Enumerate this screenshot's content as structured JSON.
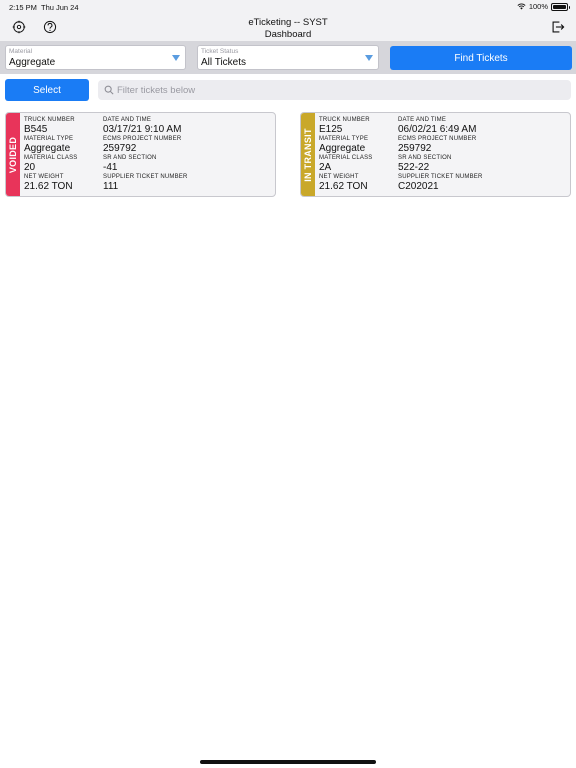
{
  "status_bar": {
    "time": "2:15 PM",
    "date": "Thu Jun 24",
    "battery": "100%"
  },
  "nav": {
    "title_line1": "eTicketing -- SYST",
    "title_line2": "Dashboard"
  },
  "filters": {
    "material": {
      "label": "Material",
      "value": "Aggregate"
    },
    "status": {
      "label": "Ticket Status",
      "value": "All Tickets"
    },
    "find_label": "Find Tickets"
  },
  "actions": {
    "select_label": "Select",
    "search_placeholder": "Filter tickets below"
  },
  "tickets": [
    {
      "status": "VOIDED",
      "status_color": "#e8345a",
      "fields": {
        "truck_number": {
          "label": "TRUCK NUMBER",
          "value": "B545"
        },
        "date_time": {
          "label": "DATE AND TIME",
          "value": "03/17/21 9:10 AM"
        },
        "material_type": {
          "label": "MATERIAL TYPE",
          "value": "Aggregate"
        },
        "ecms_project": {
          "label": "ECMS PROJECT NUMBER",
          "value": "259792"
        },
        "material_class": {
          "label": "MATERIAL CLASS",
          "value": "20"
        },
        "sr_section": {
          "label": "SR AND SECTION",
          "value": "-41"
        },
        "net_weight": {
          "label": "NET WEIGHT",
          "value": "21.62 TON"
        },
        "supplier_ticket": {
          "label": "SUPPLIER TICKET NUMBER",
          "value": "111"
        }
      }
    },
    {
      "status": "IN TRANSIT",
      "status_color": "#c9a82a",
      "fields": {
        "truck_number": {
          "label": "TRUCK NUMBER",
          "value": "E125"
        },
        "date_time": {
          "label": "DATE AND TIME",
          "value": "06/02/21 6:49 AM"
        },
        "material_type": {
          "label": "MATERIAL TYPE",
          "value": "Aggregate"
        },
        "ecms_project": {
          "label": "ECMS PROJECT NUMBER",
          "value": "259792"
        },
        "material_class": {
          "label": "MATERIAL CLASS",
          "value": "2A"
        },
        "sr_section": {
          "label": "SR AND SECTION",
          "value": "522-22"
        },
        "net_weight": {
          "label": "NET WEIGHT",
          "value": "21.62 TON"
        },
        "supplier_ticket": {
          "label": "SUPPLIER TICKET NUMBER",
          "value": "C202021"
        }
      }
    }
  ],
  "colors": {
    "accent": "#1a7cf5",
    "voided": "#e8345a",
    "in_transit": "#c9a82a"
  },
  "icons": [
    "settings-icon",
    "help-icon",
    "logout-icon",
    "search-icon",
    "wifi-icon",
    "battery-icon"
  ]
}
